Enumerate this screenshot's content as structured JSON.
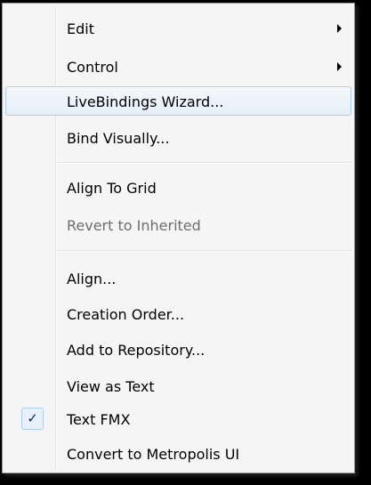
{
  "menu": {
    "items": [
      {
        "label": "Edit"
      },
      {
        "label": "Control"
      },
      {
        "label": "LiveBindings Wizard..."
      },
      {
        "label": "Bind Visually..."
      },
      {
        "label": "Align To Grid"
      },
      {
        "label": "Revert to Inherited"
      },
      {
        "label": "Align..."
      },
      {
        "label": "Creation Order..."
      },
      {
        "label": "Add to Repository..."
      },
      {
        "label": "View as Text"
      },
      {
        "label": "Text FMX"
      },
      {
        "label": "Convert to Metropolis UI"
      }
    ],
    "check_glyph": "✓",
    "highlighted_item": "LiveBindings Wizard...",
    "disabled_item": "Revert to Inherited",
    "checked_item": "Text FMX"
  },
  "icons": {
    "submenu": "chevron-right-icon",
    "check": "checkmark-icon"
  },
  "colors": {
    "highlight_border": "#aeccee",
    "highlight_fill": "#e5eef8",
    "menu_background": "#f5f5f5",
    "disabled_text": "#6d6d6d",
    "checkmark": "#0b2a6a"
  }
}
